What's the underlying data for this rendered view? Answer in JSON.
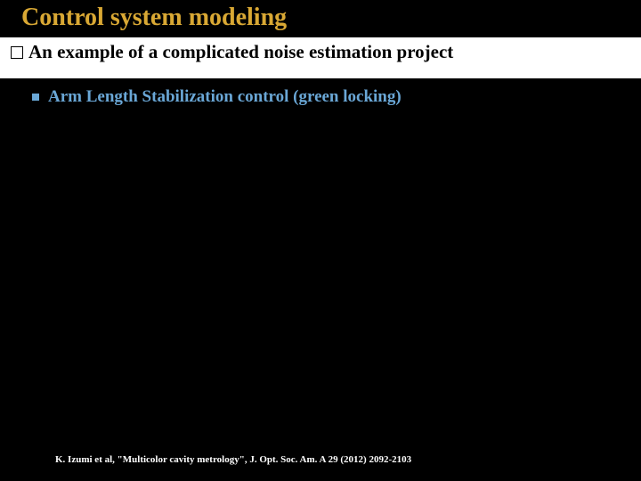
{
  "title": "Control system modeling",
  "heading": "An example of a complicated noise estimation project",
  "subheading": "Arm Length Stabilization control (green locking)",
  "citation": "K. Izumi et al, \"Multicolor cavity metrology\", J. Opt. Soc. Am. A 29 (2012) 2092-2103"
}
